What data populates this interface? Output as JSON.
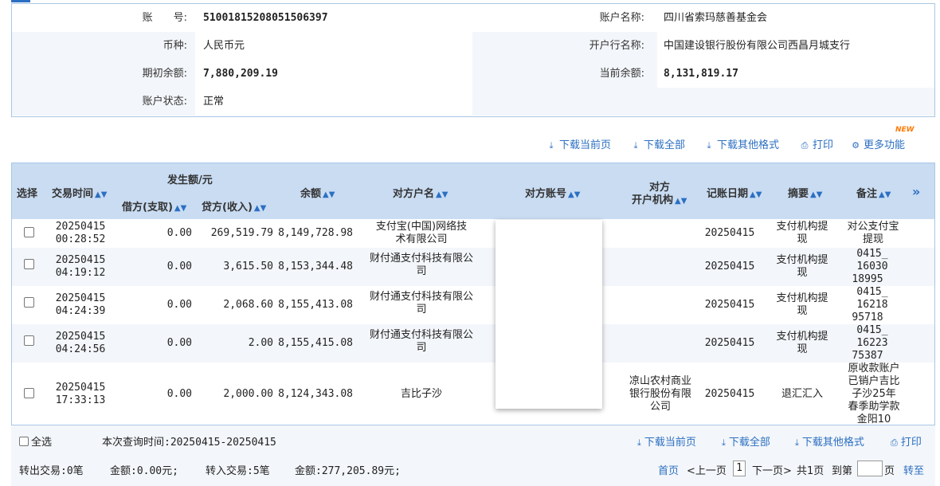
{
  "account": {
    "acct_no_label": "账　　号:",
    "acct_no": "51001815208051506397",
    "acct_name_label": "账户名称:",
    "acct_name": "四川省索玛慈善基金会",
    "currency_label": "币种:",
    "currency": "人民币元",
    "bank_label": "开户行名称:",
    "bank": "中国建设银行股份有限公司西昌月城支行",
    "opening_label": "期初余额:",
    "opening": "7,880,209.19",
    "current_label": "当前余额:",
    "current": "8,131,819.17",
    "status_label": "账户状态:",
    "status": "正常"
  },
  "toolbar": {
    "download_page": "下载当前页",
    "download_all": "下载全部",
    "download_other": "下载其他格式",
    "print": "打印",
    "more": "更多功能",
    "new_badge": "NEW"
  },
  "table": {
    "headers": {
      "select": "选择",
      "time": "交易时间",
      "amount_group": "发生额/元",
      "debit": "借方(支取)",
      "credit": "贷方(收入)",
      "balance": "余额",
      "cp_name": "对方户名",
      "cp_account": "对方账号",
      "cp_bank_1": "对方",
      "cp_bank_2": "开户机构",
      "post_date": "记账日期",
      "summary": "摘要",
      "remark": "备注",
      "more": "»"
    },
    "rows": [
      {
        "date": "20250415",
        "time": "00:28:52",
        "debit": "0.00",
        "credit": "269,519.79",
        "balance": "8,149,728.98",
        "cp_name_1": "支付宝(中国)网络技",
        "cp_name_2": "术有限公司",
        "cp_bank_1": "",
        "cp_bank_2": "",
        "cp_bank_3": "",
        "post": "20250415",
        "sum_1": "支付机构提",
        "sum_2": "现",
        "rem_1": "对公支付宝",
        "rem_2": "提现",
        "rem_3": "",
        "rem_4": "",
        "rem_5": ""
      },
      {
        "date": "20250415",
        "time": "04:19:12",
        "debit": "0.00",
        "credit": "3,615.50",
        "balance": "8,153,344.48",
        "cp_name_1": "财付通支付科技有限公",
        "cp_name_2": "司",
        "cp_bank_1": "",
        "cp_bank_2": "",
        "cp_bank_3": "",
        "post": "20250415",
        "sum_1": "支付机构提",
        "sum_2": "现",
        "rem_1": "0415_",
        "rem_2": "16030",
        "rem_3": "18995",
        "rem_4": "",
        "rem_5": ""
      },
      {
        "date": "20250415",
        "time": "04:24:39",
        "debit": "0.00",
        "credit": "2,068.60",
        "balance": "8,155,413.08",
        "cp_name_1": "财付通支付科技有限公",
        "cp_name_2": "司",
        "cp_bank_1": "",
        "cp_bank_2": "",
        "cp_bank_3": "",
        "post": "20250415",
        "sum_1": "支付机构提",
        "sum_2": "现",
        "rem_1": "0415_",
        "rem_2": "16218",
        "rem_3": "95718",
        "rem_4": "",
        "rem_5": ""
      },
      {
        "date": "20250415",
        "time": "04:24:56",
        "debit": "0.00",
        "credit": "2.00",
        "balance": "8,155,415.08",
        "cp_name_1": "财付通支付科技有限公",
        "cp_name_2": "司",
        "cp_bank_1": "",
        "cp_bank_2": "",
        "cp_bank_3": "",
        "post": "20250415",
        "sum_1": "支付机构提",
        "sum_2": "现",
        "rem_1": "0415_",
        "rem_2": "16223",
        "rem_3": "75387",
        "rem_4": "",
        "rem_5": ""
      },
      {
        "date": "20250415",
        "time": "17:33:13",
        "debit": "0.00",
        "credit": "2,000.00",
        "balance": "8,124,343.08",
        "cp_name_1": "吉比子沙",
        "cp_name_2": "",
        "cp_bank_1": "凉山农村商业",
        "cp_bank_2": "银行股份有限",
        "cp_bank_3": "公司",
        "post": "20250415",
        "sum_1": "退汇汇入",
        "sum_2": "",
        "rem_1": "原收款账户",
        "rem_2": "已销户吉比",
        "rem_3": "子沙25年",
        "rem_4": "春季助学款",
        "rem_5": "金阳10"
      }
    ]
  },
  "footer": {
    "select_all": "全选",
    "query_time": "本次查询时间:20250415-20250415",
    "download_page": "下载当前页",
    "download_all": "下载全部",
    "download_other": "下载其他格式",
    "print": "打印",
    "out_txn": "转出交易:0笔",
    "out_amt": "金额:0.00元;",
    "in_txn": "转入交易:5笔",
    "in_amt": "金额:277,205.89元;",
    "first": "首页",
    "prev": "<上一页",
    "page": "1",
    "next": "下一页>",
    "total": "共1页",
    "goto": "到第",
    "page_unit": "页",
    "go": "转至"
  }
}
